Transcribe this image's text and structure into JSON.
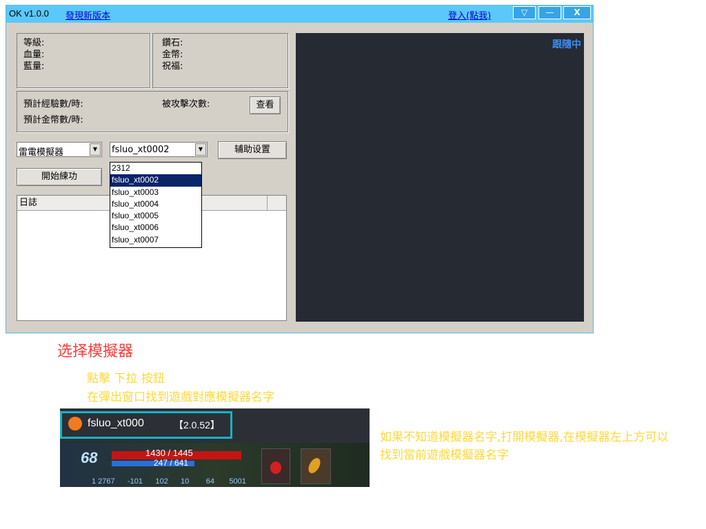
{
  "window": {
    "title": "OK v1.0.0",
    "update_link": "發現新版本",
    "login_link": "登入(點我)",
    "menu_btn": "▽",
    "min_btn": "—",
    "close_btn": "X"
  },
  "stats": {
    "level": "等級:",
    "hp": "血量:",
    "mp": "藍量:",
    "diamond": "鑽石:",
    "gold": "金幣:",
    "blessing": "祝福:"
  },
  "estimates": {
    "exp_per_hour": "預計經驗數/時:",
    "gold_per_hour": "預計金幣數/時:",
    "attacked": "被攻擊次數:",
    "view_btn": "查看"
  },
  "controls": {
    "emulator_value": "雷電模擬器",
    "window_value": "fsluo_xt0002",
    "assist_btn": "辅助设置",
    "start_btn": "開始練功"
  },
  "dropdown": {
    "options": [
      "2312",
      "fsluo_xt0002",
      "fsluo_xt0003",
      "fsluo_xt0004",
      "fsluo_xt0005",
      "fsluo_xt0006",
      "fsluo_xt0007"
    ],
    "selected_index": 1
  },
  "log": {
    "header": "日誌"
  },
  "follow": {
    "status": "跟隨中"
  },
  "instructions": {
    "title": "选择模擬器",
    "step1": "點擊 下拉 按鈕",
    "step2": "在彈出窗口找到遊戲對應模擬器名字",
    "note": "如果不知道模擬器名字,打開模擬器,在模擬器左上方可以找到當前遊戲模擬器名字"
  },
  "example": {
    "emulator_name": "fsluo_xt000",
    "version": "【2.0.52】",
    "level": "68",
    "hp": "1430 / 1445",
    "mp": "247 / 641",
    "stats_line": "1 2767      -101      102      10        64       5001"
  },
  "colors": {
    "titlebar": "#5ac8fa",
    "window_bg": "#d4d0c8",
    "right_panel": "#262a33",
    "follow_text": "#3c8ef0",
    "instr_title": "#ff3b3b",
    "instr_text": "#ffd83a",
    "highlight_border": "#17b3c4"
  }
}
